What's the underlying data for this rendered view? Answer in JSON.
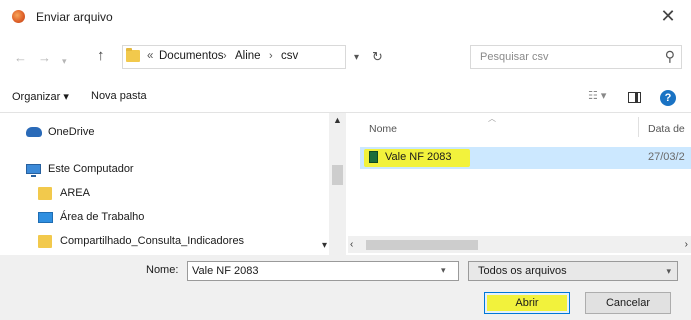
{
  "window": {
    "title": "Enviar arquivo",
    "close_glyph": "✕",
    "icon": "firefox-icon"
  },
  "navigation": {
    "breadcrumb": {
      "overflow": "«",
      "items": [
        "Documentos",
        "Aline",
        "csv"
      ],
      "separator": "›"
    },
    "search_placeholder": "Pesquisar csv"
  },
  "toolbar": {
    "organize_label": "Organizar ▾",
    "new_folder_label": "Nova pasta"
  },
  "nav_pane": {
    "items": [
      {
        "label": "OneDrive",
        "icon": "cloud-icon"
      },
      {
        "label": "Este Computador",
        "icon": "computer-icon"
      },
      {
        "label": "AREA",
        "icon": "folder-icon"
      },
      {
        "label": "Área de Trabalho",
        "icon": "desktop-icon"
      },
      {
        "label": "Compartilhado_Consulta_Indicadores",
        "icon": "folder-icon"
      }
    ]
  },
  "file_list": {
    "columns": [
      "Nome",
      "Data de"
    ],
    "files": [
      {
        "name": "Vale NF 2083",
        "date": "27/03/2",
        "selected": true,
        "highlight_color": "#f2f23c"
      }
    ]
  },
  "footer": {
    "name_label": "Nome:",
    "name_value": "Vale NF 2083",
    "file_type": "Todos os arquivos",
    "open_label": "Abrir",
    "cancel_label": "Cancelar"
  },
  "colors": {
    "selection": "#cce8ff",
    "highlight": "#f2f23c",
    "accent": "#0078d7"
  }
}
